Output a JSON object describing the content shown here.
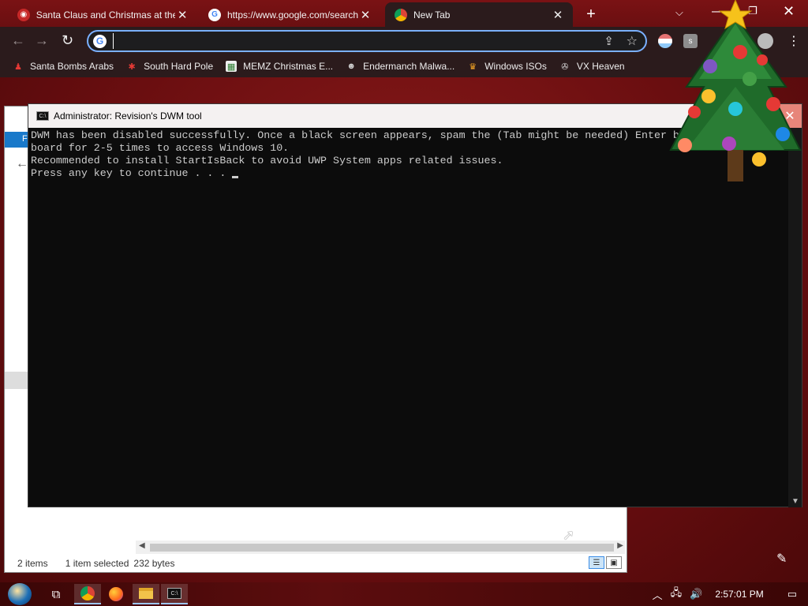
{
  "browser": {
    "tabs": [
      {
        "title": "Santa Claus and Christmas at the",
        "favicon": "santa-favicon",
        "active": false
      },
      {
        "title": "https://www.google.com/search",
        "favicon": "google-favicon",
        "active": false
      },
      {
        "title": "New Tab",
        "favicon": "chrome-favicon",
        "active": true
      }
    ],
    "tab_close_glyph": "✕",
    "new_tab_glyph": "+",
    "tab_list_glyph": "⌵",
    "window_minimize_glyph": "—",
    "window_maximize_glyph": "❐",
    "window_close_glyph": "✕",
    "nav": {
      "back": "←",
      "forward": "→",
      "reload": "↻"
    },
    "omnibox": {
      "value": "",
      "placeholder": ""
    },
    "bookmarks": [
      {
        "label": "Santa Bombs Arabs",
        "icon": "santa-icon"
      },
      {
        "label": "South Hard Pole",
        "icon": "snowflake-icon"
      },
      {
        "label": "MEMZ Christmas E...",
        "icon": "memz-icon"
      },
      {
        "label": "Endermanch Malwa...",
        "icon": "enderman-icon"
      },
      {
        "label": "Windows ISOs",
        "icon": "windows-iso-icon"
      },
      {
        "label": "VX Heaven",
        "icon": "vx-heaven-icon"
      }
    ]
  },
  "explorer": {
    "ribbon_label": "Fi",
    "status": {
      "items": "2 items",
      "selected": "1 item selected",
      "size": "232 bytes"
    }
  },
  "console": {
    "title": "Administrator:  Revision's DWM tool",
    "lines": [
      "DWM has been disabled successfully. Once a black screen appears, spam the (Tab might be needed) Enter b",
      "board for 2-5 times to access Windows 10.",
      "Recommended to install StartIsBack to avoid UWP System apps related issues.",
      "Press any key to continue . . . "
    ]
  },
  "taskbar": {
    "clock": "2:57:01 PM",
    "apps": [
      "task-view",
      "chrome",
      "firefox",
      "file-explorer",
      "command-prompt"
    ]
  },
  "colors": {
    "desktop_bg": "#6a0e10",
    "chrome_frame": "#2b1b1c",
    "omnibox_focus": "#7ab0ff",
    "console_bg": "#0c0c0c",
    "console_text": "#cccccc"
  }
}
